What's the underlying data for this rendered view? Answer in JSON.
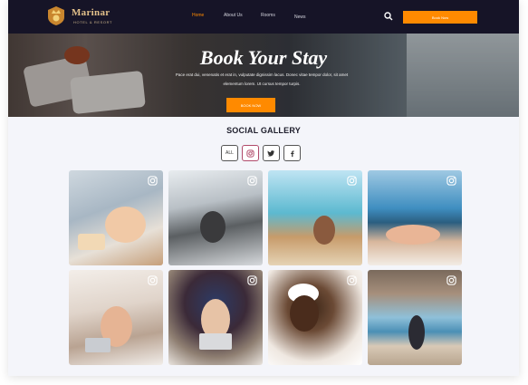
{
  "header": {
    "brand_name": "Marinar",
    "brand_tagline": "HOTEL & RESORT",
    "nav": [
      "Home",
      "About Us",
      "Rooms",
      "News"
    ],
    "active_nav": "Home",
    "cta_label": "Book Now",
    "accent_color": "#ff8a00",
    "bg_color": "#161427"
  },
  "hero": {
    "title": "Book Your Stay",
    "text_line1": "Pace erat dui, venenatis et erat in, vulputate dignissim lacus. Donec vitae tempor dolor, sit amet",
    "text_line2": "elementum lorem. Ut cursus tempor turpis.",
    "button_label": "BOOK NOW"
  },
  "gallery": {
    "title": "SOCIAL GALLERY",
    "filters": [
      "ALL",
      "instagram",
      "twitter",
      "facebook"
    ],
    "filter_all_label": "ALL",
    "items": [
      {
        "scene": "woman in bed with breakfast tray",
        "icon": "instagram-icon"
      },
      {
        "scene": "woman on bed by snowy window",
        "icon": "instagram-icon"
      },
      {
        "scene": "woman on overwater villa deck",
        "icon": "instagram-icon"
      },
      {
        "scene": "feet by infinity pool",
        "icon": "instagram-icon"
      },
      {
        "scene": "woman with laptop on bed",
        "icon": "instagram-icon"
      },
      {
        "scene": "woman with laptop under mandala tapestry",
        "icon": "instagram-icon"
      },
      {
        "scene": "woman in towel on phone",
        "icon": "instagram-icon"
      },
      {
        "scene": "woman on pier by the sea",
        "icon": "instagram-icon"
      }
    ]
  }
}
